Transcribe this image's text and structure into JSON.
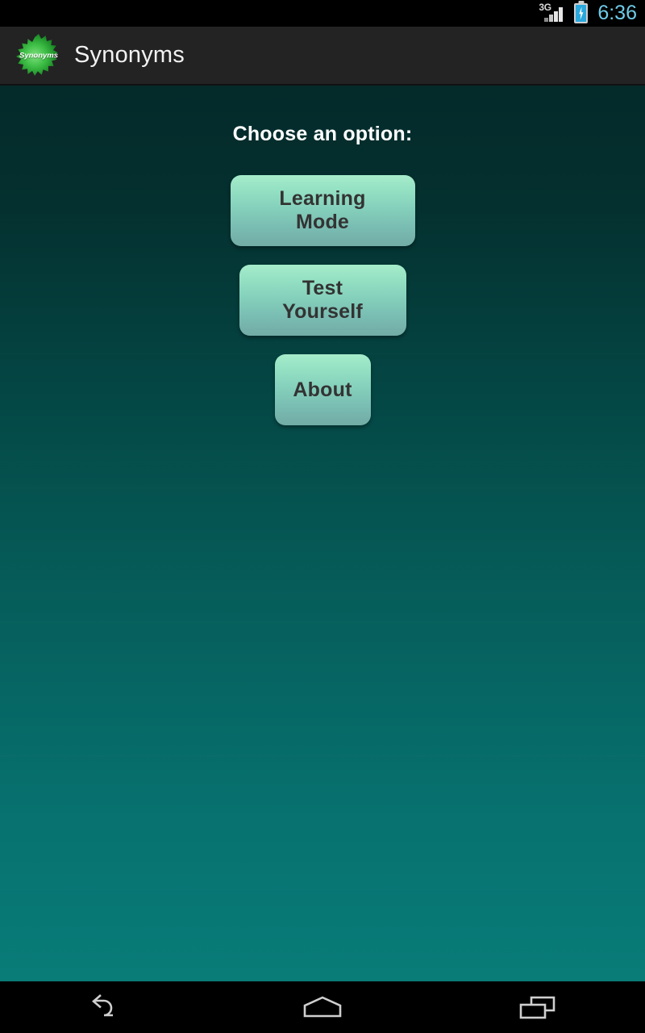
{
  "status_bar": {
    "network_label": "3G",
    "signal_icon": "signal-bars-icon",
    "battery_icon": "battery-charging-icon",
    "time": "6:36",
    "time_color": "#6ecbe8"
  },
  "action_bar": {
    "app_icon": "synonyms-starburst-icon",
    "app_icon_label": "Synonyms",
    "title": "Synonyms",
    "background_color": "#232323"
  },
  "content": {
    "heading": "Choose an option:",
    "background_gradient_top": "#042a2a",
    "background_gradient_bottom": "#097c78",
    "buttons": [
      {
        "label": "Learning Mode",
        "name": "learning-mode-button"
      },
      {
        "label": "Test Yourself",
        "name": "test-yourself-button"
      },
      {
        "label": "About",
        "name": "about-button"
      }
    ],
    "button_gradient_top": "#a5ecca",
    "button_gradient_bottom": "#72aba5",
    "button_text_color": "#333333"
  },
  "nav_bar": {
    "back_icon": "back-arrow-icon",
    "home_icon": "home-icon",
    "recents_icon": "recents-icon"
  }
}
